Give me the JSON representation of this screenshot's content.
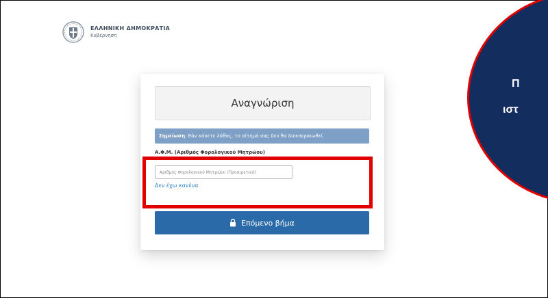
{
  "brand": {
    "title": "ΕΛΛΗΝΙΚΗ ΔΗΜΟΚΡΑΤΙΑ",
    "subtitle": "Κυβέρνηση"
  },
  "card": {
    "title": "Αναγνώριση",
    "note_bold": "Σημείωση",
    "note_text": ": Εάν κάνετε λάθος, το αίτημά σας δεν θα διεκπεραιωθεί.",
    "field_label": "Α.Φ.Μ. (Αριθμός Φορολογικού Μητρώου)",
    "field_placeholder": "Αριθμός Φορολογικού Μητρώου (Προαιρετικό)",
    "field_value": "",
    "none_link": "Δεν έχω κανένα",
    "next_button": "Επόμενο βήμα"
  },
  "overlay": {
    "line1": "Π",
    "line2": "ιστ"
  },
  "colors": {
    "primary_button": "#2b6aa8",
    "note_bg": "#7e9fc6",
    "highlight": "#e00000",
    "circle": "#142d5f",
    "link": "#2a7ec7"
  },
  "icons": [
    "government-emblem-icon",
    "lock-icon"
  ]
}
